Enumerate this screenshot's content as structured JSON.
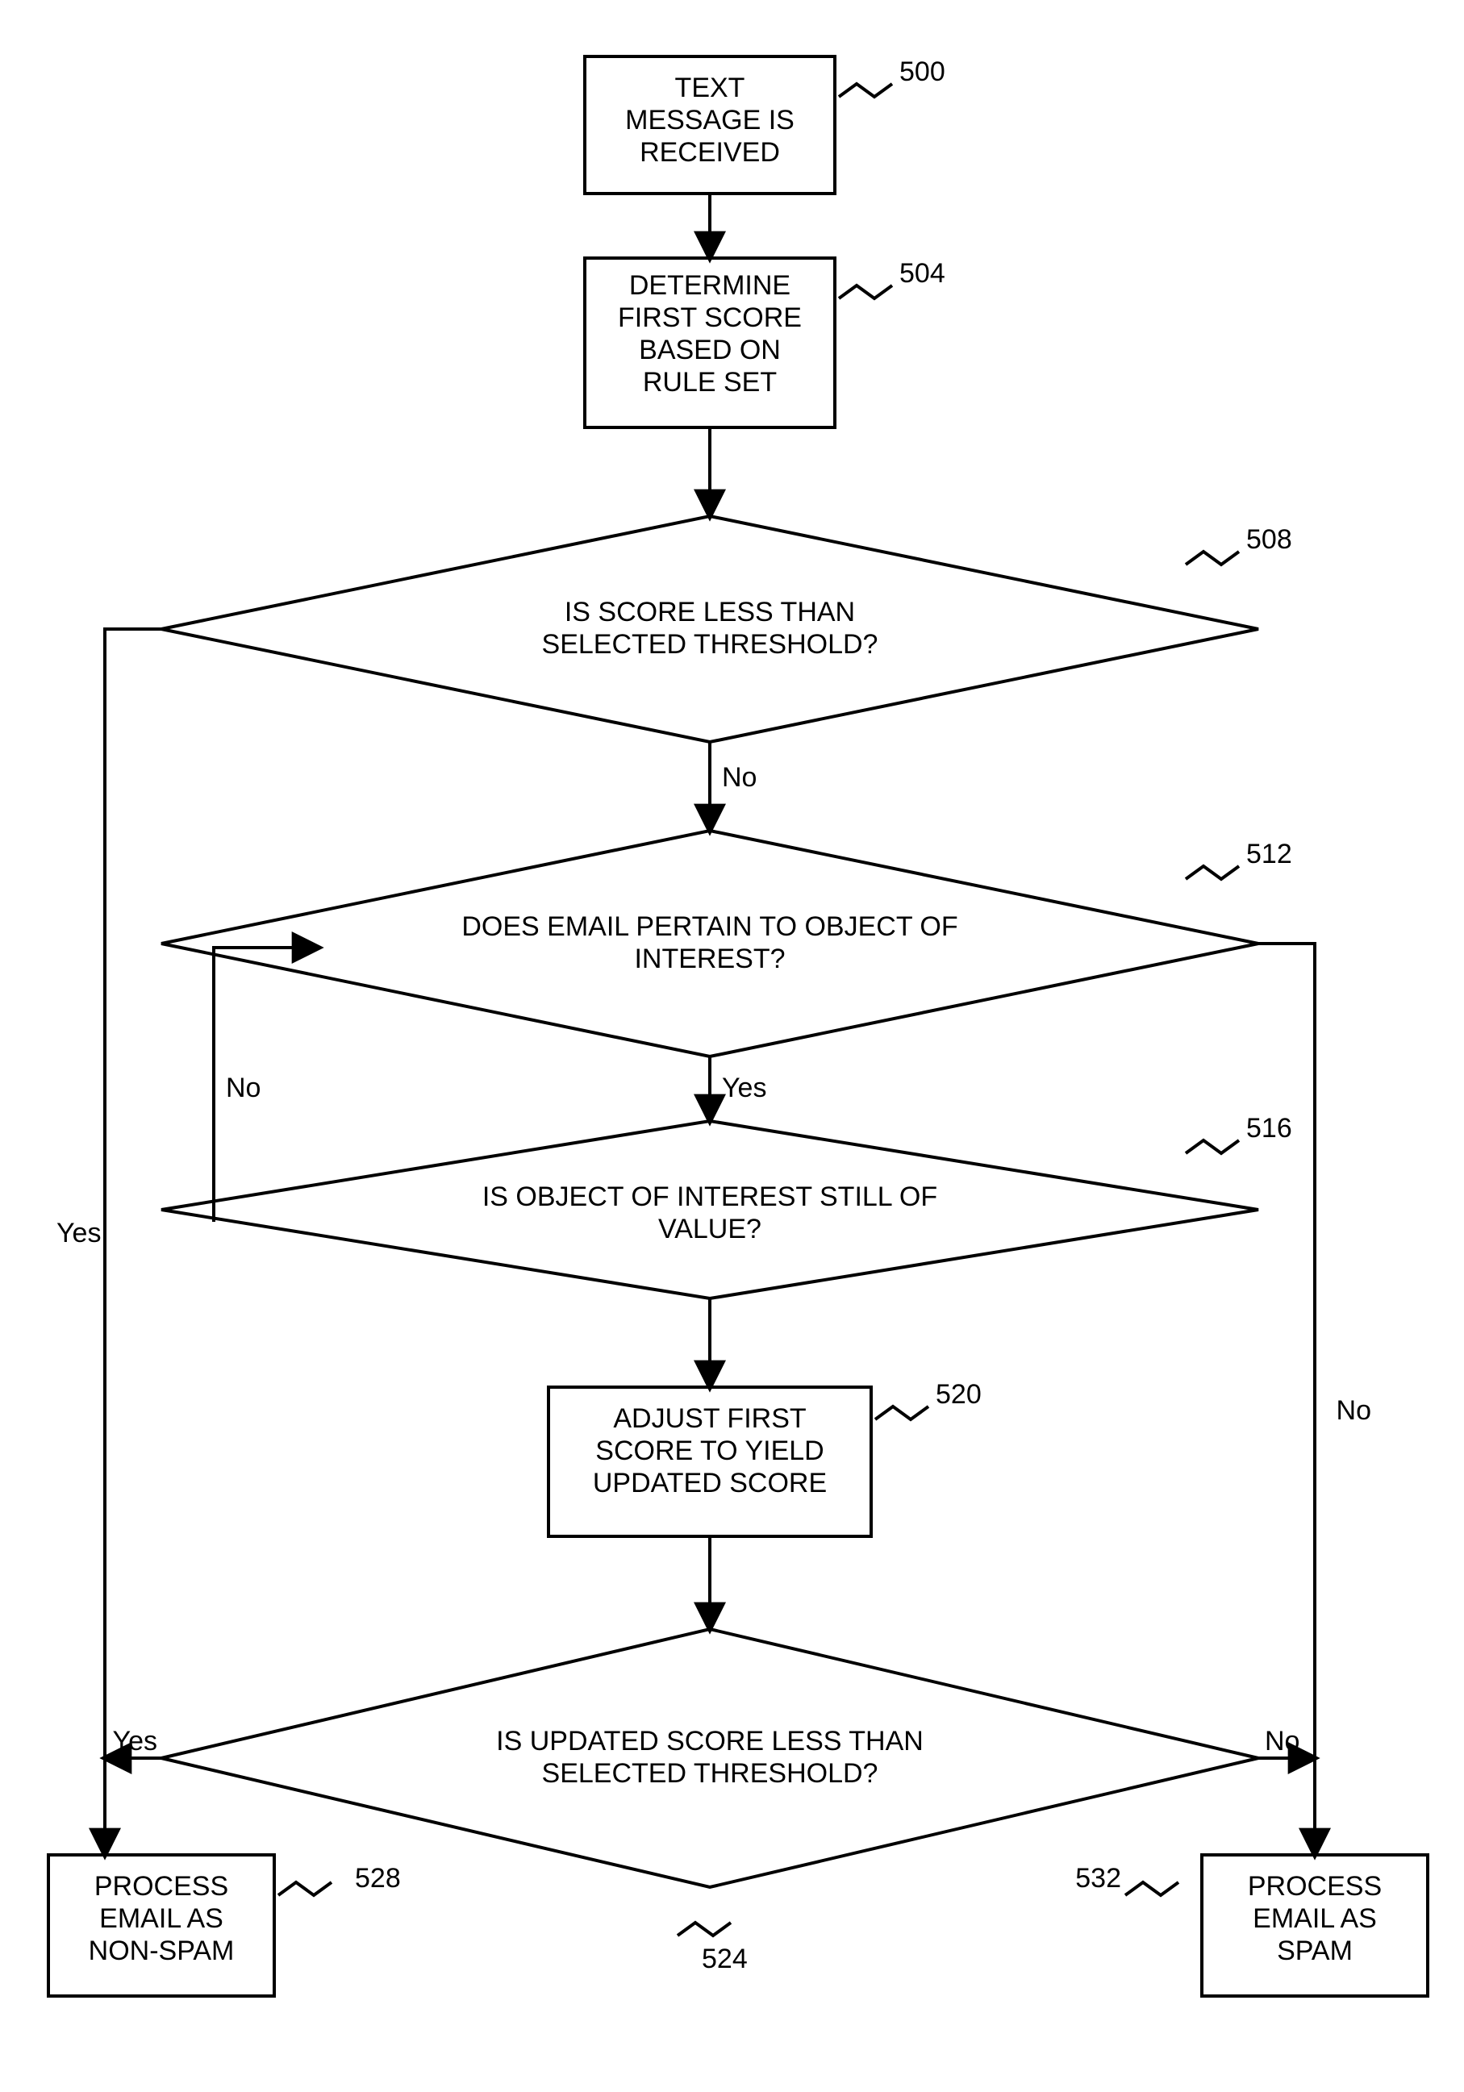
{
  "refs": {
    "n500": "500",
    "n504": "504",
    "n508": "508",
    "n512": "512",
    "n516": "516",
    "n520": "520",
    "n524": "524",
    "n528": "528",
    "n532": "532"
  },
  "edges": {
    "yes": "Yes",
    "no": "No"
  },
  "boxes": {
    "b500": {
      "l1": "TEXT",
      "l2": "MESSAGE IS",
      "l3": "RECEIVED"
    },
    "b504": {
      "l1": "DETERMINE",
      "l2": "FIRST SCORE",
      "l3": "BASED ON",
      "l4": "RULE SET"
    },
    "b520": {
      "l1": "ADJUST FIRST",
      "l2": "SCORE TO YIELD",
      "l3": "UPDATED SCORE"
    },
    "b528": {
      "l1": "PROCESS",
      "l2": "EMAIL AS",
      "l3": "NON-SPAM"
    },
    "b532": {
      "l1": "PROCESS",
      "l2": "EMAIL AS",
      "l3": "SPAM"
    }
  },
  "diamonds": {
    "d508": {
      "l1": "IS SCORE LESS THAN",
      "l2": "SELECTED THRESHOLD?"
    },
    "d512": {
      "l1": "DOES EMAIL PERTAIN TO OBJECT OF",
      "l2": "INTEREST?"
    },
    "d516": {
      "l1": "IS OBJECT OF INTEREST STILL OF",
      "l2": "VALUE?"
    },
    "d524": {
      "l1": "IS UPDATED SCORE LESS THAN",
      "l2": "SELECTED THRESHOLD?"
    }
  }
}
